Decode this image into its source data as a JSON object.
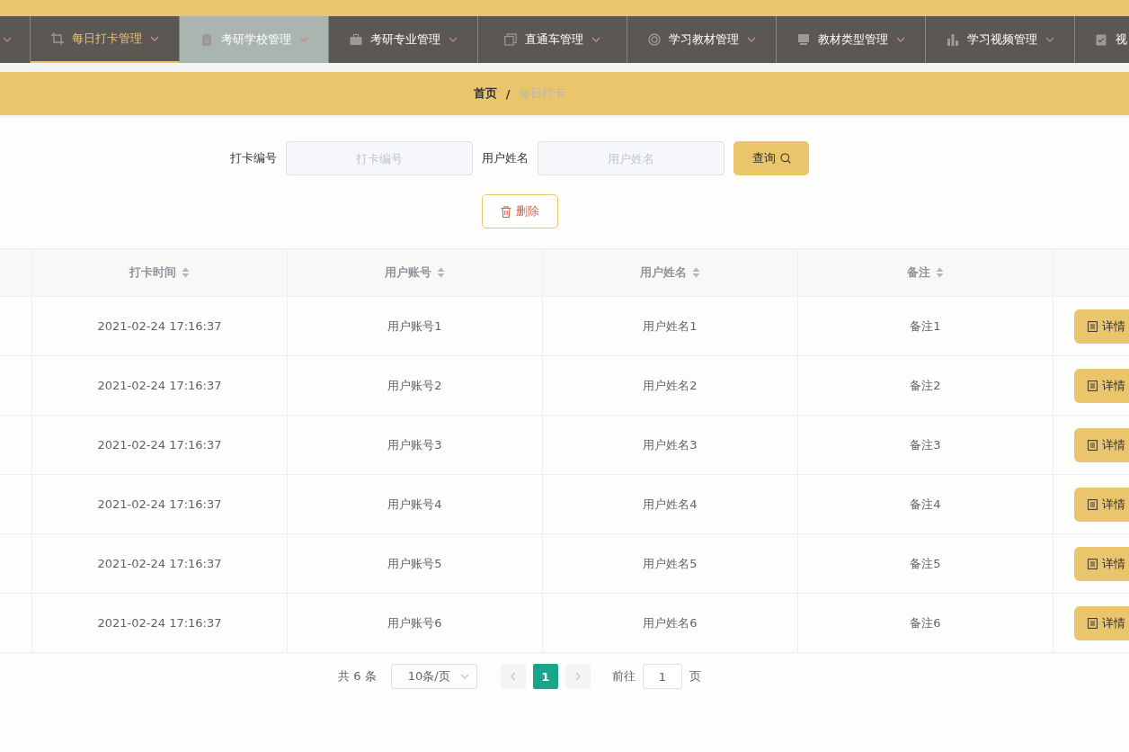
{
  "nav": {
    "items": [
      {
        "label": "每日打卡管理",
        "selected": true,
        "hovered": false
      },
      {
        "label": "考研学校管理",
        "selected": false,
        "hovered": true
      },
      {
        "label": "考研专业管理",
        "selected": false,
        "hovered": false
      },
      {
        "label": "直通车管理",
        "selected": false,
        "hovered": false
      },
      {
        "label": "学习教材管理",
        "selected": false,
        "hovered": false
      },
      {
        "label": "教材类型管理",
        "selected": false,
        "hovered": false
      },
      {
        "label": "学习视频管理",
        "selected": false,
        "hovered": false
      },
      {
        "label": "视",
        "selected": false,
        "hovered": false
      }
    ]
  },
  "breadcrumb": {
    "items": [
      "首页",
      "每日打卡"
    ],
    "separator": "/"
  },
  "search": {
    "fields": [
      {
        "label": "打卡编号",
        "placeholder": "打卡编号"
      },
      {
        "label": "用户姓名",
        "placeholder": "用户姓名"
      }
    ],
    "query_button": "查询",
    "delete_button": "删除"
  },
  "table": {
    "columns": [
      "打卡时间",
      "用户账号",
      "用户姓名",
      "备注"
    ],
    "rows": [
      {
        "cells": [
          "2021-02-24 17:16:37",
          "用户账号1",
          "用户姓名1",
          "备注1"
        ],
        "action": "详情"
      },
      {
        "cells": [
          "2021-02-24 17:16:37",
          "用户账号2",
          "用户姓名2",
          "备注2"
        ],
        "action": "详情"
      },
      {
        "cells": [
          "2021-02-24 17:16:37",
          "用户账号3",
          "用户姓名3",
          "备注3"
        ],
        "action": "详情"
      },
      {
        "cells": [
          "2021-02-24 17:16:37",
          "用户账号4",
          "用户姓名4",
          "备注4"
        ],
        "action": "详情"
      },
      {
        "cells": [
          "2021-02-24 17:16:37",
          "用户账号5",
          "用户姓名5",
          "备注5"
        ],
        "action": "详情"
      },
      {
        "cells": [
          "2021-02-24 17:16:37",
          "用户账号6",
          "用户姓名6",
          "备注6"
        ],
        "action": "详情"
      }
    ]
  },
  "pagination": {
    "total": "共 6 条",
    "page_size": "10条/页",
    "pages": [
      {
        "label": "1",
        "selected": true
      }
    ],
    "goto_label": "前往",
    "goto_value": "1",
    "page_suffix": "页"
  }
}
